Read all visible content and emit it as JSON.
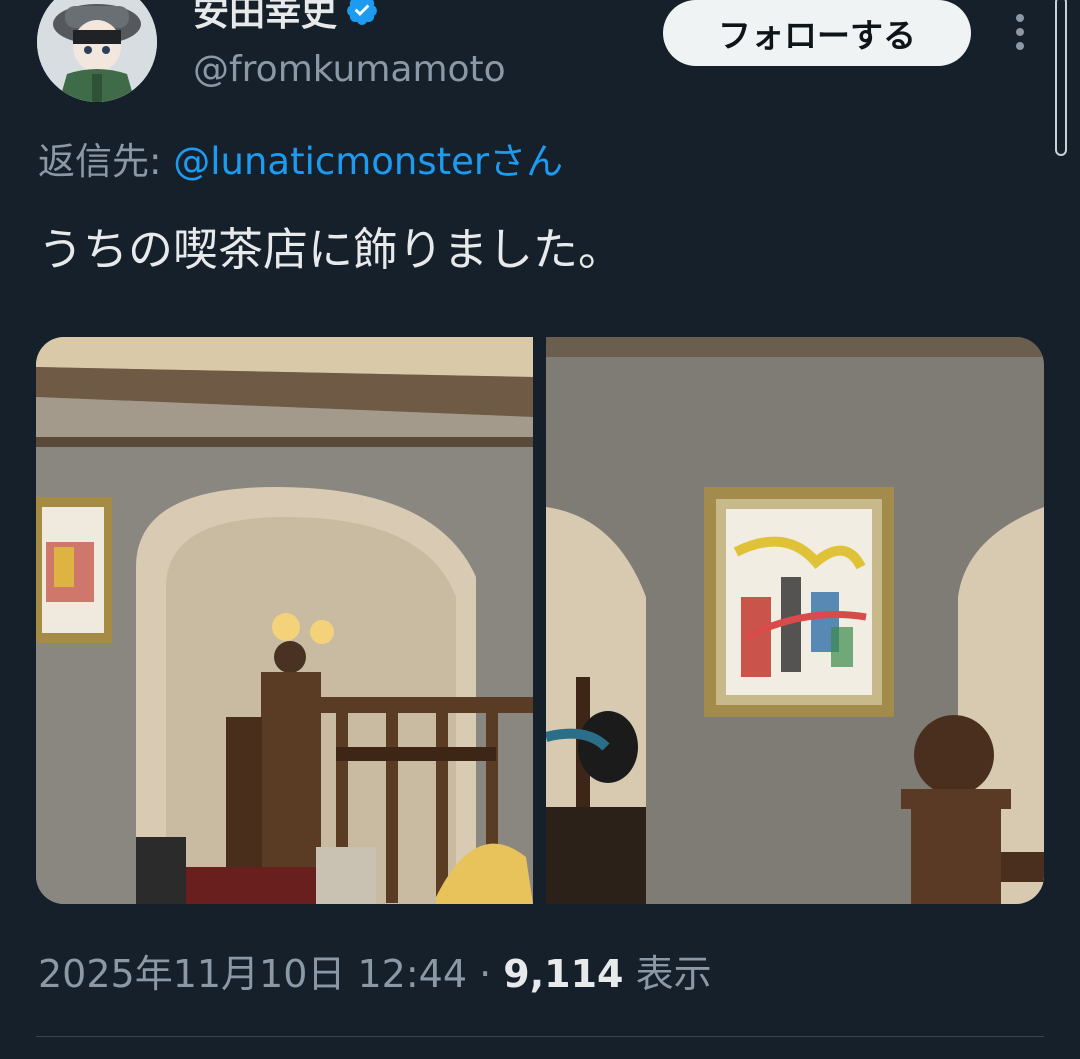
{
  "author": {
    "display_name": "安田幸史",
    "handle": "@fromkumamoto",
    "verified_icon": "verified-badge-icon"
  },
  "follow_button": {
    "label": "フォローする"
  },
  "more_menu": {
    "icon": "more-vertical-icon"
  },
  "reply": {
    "prefix": "返信先:",
    "mention": "@lunaticmonsterさん"
  },
  "tweet": {
    "text": "うちの喫茶店に飾りました。"
  },
  "media": {
    "photos": [
      {
        "description_icon": "photo-cafe-interior-arch"
      },
      {
        "description_icon": "photo-framed-painting"
      }
    ]
  },
  "meta": {
    "timestamp": "2025年11月10日 12:44",
    "separator": "·",
    "views_count": "9,114",
    "views_label": "表示"
  },
  "colors": {
    "background": "#15202b",
    "accent": "#1d9bf0",
    "secondary_text": "#8b98a5"
  }
}
